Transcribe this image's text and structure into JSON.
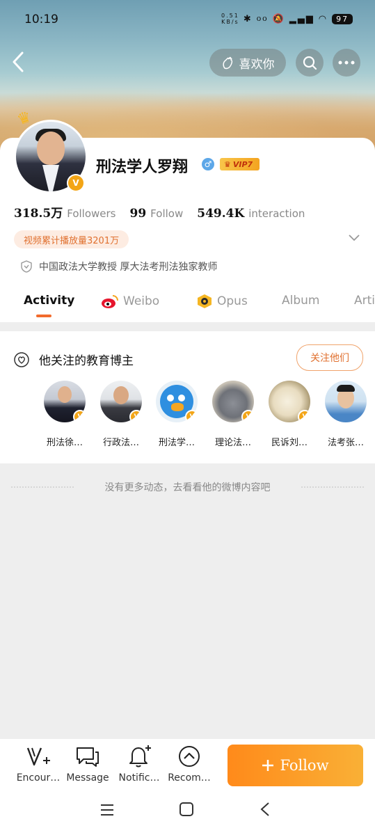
{
  "status_bar": {
    "time": "10:19",
    "net_speed": "0.51",
    "net_unit": "KB/s",
    "battery": "97"
  },
  "header": {
    "like_label": "喜欢你"
  },
  "profile": {
    "name": "刑法学人罗翔",
    "gender_icon": "male-icon",
    "vip_label": "VIP7",
    "verified_badge": "V",
    "followers_value": "318.5万",
    "followers_label": "Followers",
    "follow_value": "99",
    "follow_label": "Follow",
    "interaction_value": "549.4K",
    "interaction_label": "interaction",
    "video_plays": "视频累计播放量3201万",
    "bio": "中国政法大学教授 厚大法考刑法独家教师"
  },
  "tabs": [
    {
      "label": "Activity",
      "active": true
    },
    {
      "label": "Weibo",
      "active": false
    },
    {
      "label": "Opus",
      "active": false
    },
    {
      "label": "Album",
      "active": false
    },
    {
      "label": "Arti",
      "active": false
    }
  ],
  "recommendations": {
    "title": "他关注的教育博主",
    "follow_label": "关注他们",
    "users": [
      {
        "name": "刑法徐…"
      },
      {
        "name": "行政法…"
      },
      {
        "name": "刑法学…"
      },
      {
        "name": "理论法…"
      },
      {
        "name": "民诉刘…"
      },
      {
        "name": "法考张…"
      }
    ]
  },
  "empty_message": "没有更多动态，去看看他的微博内容吧",
  "actions": [
    {
      "label": "Encour…",
      "icon": "encourage-icon"
    },
    {
      "label": "Message",
      "icon": "message-icon"
    },
    {
      "label": "Notific…",
      "icon": "notification-icon"
    },
    {
      "label": "Recom…",
      "icon": "recommend-icon"
    }
  ],
  "follow_button": {
    "label": "Follow"
  },
  "colors": {
    "accent": "#f26b2c",
    "follow_gradient_start": "#ff8a1a",
    "follow_gradient_end": "#f9b036",
    "verified": "#f3a516"
  }
}
